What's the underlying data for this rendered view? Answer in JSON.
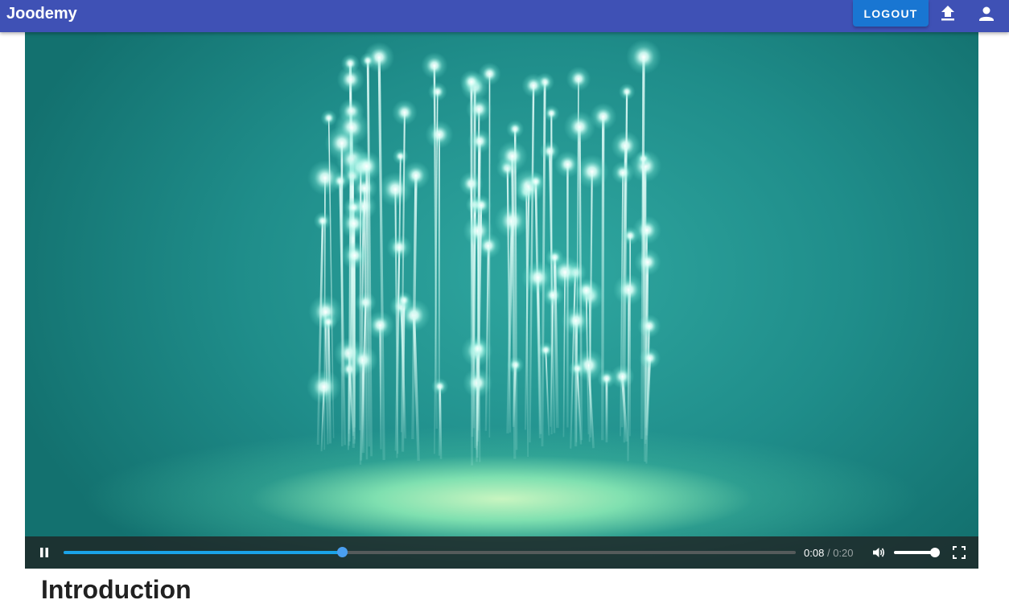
{
  "appbar": {
    "brand": "Joodemy",
    "logout_label": "LOGOUT",
    "upload_icon": "upload-icon",
    "account_icon": "account-icon",
    "background": "#3f51b5",
    "button_color": "#1976d2"
  },
  "video": {
    "current_time": "0:08",
    "separator": "/",
    "duration": "0:20",
    "progress_fraction": 0.38,
    "volume_fraction": 0.95,
    "playing": true,
    "accent": "#1aa3e8"
  },
  "content": {
    "title": "Introduction"
  }
}
